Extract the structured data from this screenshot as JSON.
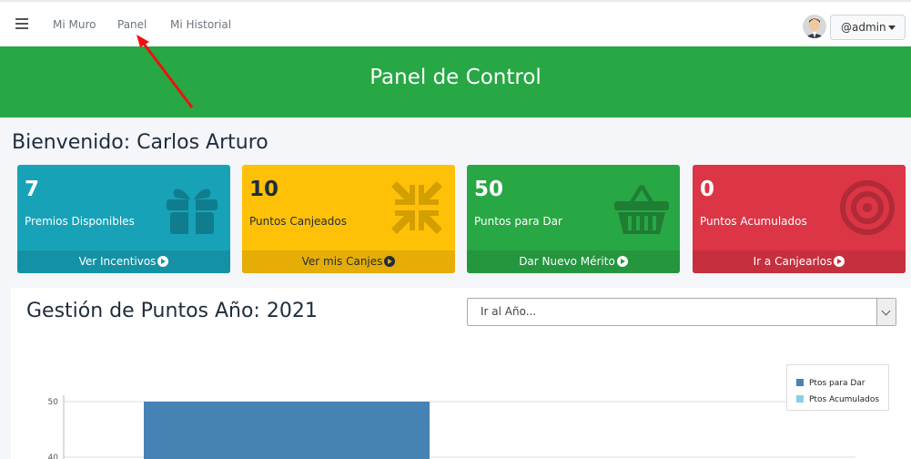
{
  "nav": {
    "links": [
      "Mi Muro",
      "Panel",
      "Mi Historial"
    ],
    "user": "@admin"
  },
  "header": {
    "title": "Panel de Control"
  },
  "welcome": "Bienvenido: Carlos Arturo",
  "boxes": [
    {
      "value": "7",
      "label": "Premios Disponibles",
      "footer": "Ver Incentivos",
      "icon": "gift-icon",
      "color": "#17a2b8"
    },
    {
      "value": "10",
      "label": "Puntos Canjeados",
      "footer": "Ver mis Canjes",
      "icon": "compress-arrows-icon",
      "color": "#ffc107"
    },
    {
      "value": "50",
      "label": "Puntos para Dar",
      "footer": "Dar Nuevo Mérito",
      "icon": "shopping-basket-icon",
      "color": "#28a745"
    },
    {
      "value": "0",
      "label": "Puntos Acumulados",
      "footer": "Ir a Canjearlos",
      "icon": "bullseye-icon",
      "color": "#dc3545"
    }
  ],
  "card": {
    "title": "Gestión de Puntos Año: 2021",
    "select_placeholder": "Ir al Año..."
  },
  "chart_data": {
    "type": "bar",
    "series": [
      {
        "name": "Ptos para Dar",
        "color": "#4682b4",
        "values": [
          50
        ]
      },
      {
        "name": "Ptos Acumulados",
        "color": "#87ceeb",
        "values": [
          0
        ]
      }
    ],
    "y_ticks": [
      "50",
      "40"
    ],
    "ylim": [
      0,
      50
    ],
    "legend": "top-right"
  }
}
